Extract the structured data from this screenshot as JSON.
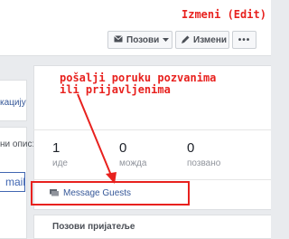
{
  "header": {
    "invite_label": "Позови",
    "edit_label": "Измени",
    "more_label": "•••"
  },
  "annotations": {
    "top": "Izmeni (Edit)",
    "middle": "pošalji poruku pozvanima ili prijavljenima"
  },
  "left_panel": {
    "text1": "кацију",
    "text2": "ни опис:",
    "mail": "mail"
  },
  "stats": [
    {
      "value": "1",
      "label": "иде"
    },
    {
      "value": "0",
      "label": "можда"
    },
    {
      "value": "0",
      "label": "позвано"
    }
  ],
  "message_guests": "Message Guests",
  "invite_friends_section": "Позови пријатеље",
  "colors": {
    "annotation": "#e8211e",
    "link": "#365899"
  }
}
